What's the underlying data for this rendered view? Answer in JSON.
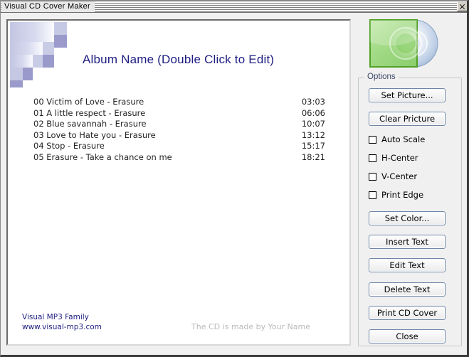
{
  "window": {
    "title": "Visual CD Cover Maker",
    "close_icon": "close-icon"
  },
  "cover": {
    "album_title": "Album Name (Double Click to Edit)",
    "tracks": [
      {
        "title": "00 Victim of Love - Erasure",
        "time": "03:03"
      },
      {
        "title": "01 A little respect - Erasure",
        "time": "06:06"
      },
      {
        "title": "02 Blue savannah - Erasure",
        "time": "10:07"
      },
      {
        "title": "03 Love to Hate you - Erasure",
        "time": "13:12"
      },
      {
        "title": "04 Stop - Erasure",
        "time": "15:17"
      },
      {
        "title": "05 Erasure - Take a chance on me",
        "time": "18:21"
      }
    ],
    "footer_line1": "Visual MP3 Family",
    "footer_line2": "www.visual-mp3.com",
    "footer_credit": "The CD is made by Your Name",
    "title_color": "#1d1d82",
    "credit_color": "#b9b9b9",
    "deco_color": "#9999cc"
  },
  "cd_icon": {
    "name": "cd-case-icon",
    "case_color": "#7cc242",
    "disc_color": "#c9d8ec"
  },
  "options": {
    "legend": "Options",
    "buttons_top": [
      {
        "label": "Set Picture...",
        "name": "set-picture-button"
      },
      {
        "label": "Clear Pricture",
        "name": "clear-picture-button"
      }
    ],
    "checkboxes": [
      {
        "label": "Auto Scale",
        "checked": false
      },
      {
        "label": "H-Center",
        "checked": false
      },
      {
        "label": "V-Center",
        "checked": false
      },
      {
        "label": "Print Edge",
        "checked": false
      }
    ],
    "buttons_bottom": [
      {
        "label": "Set Color...",
        "name": "set-color-button"
      },
      {
        "label": "Insert Text",
        "name": "insert-text-button"
      },
      {
        "label": "Edit Text",
        "name": "edit-text-button"
      },
      {
        "label": "Delete Text",
        "name": "delete-text-button"
      },
      {
        "label": "Print CD Cover",
        "name": "print-cd-cover-button"
      },
      {
        "label": "Close",
        "name": "close-button"
      }
    ]
  }
}
